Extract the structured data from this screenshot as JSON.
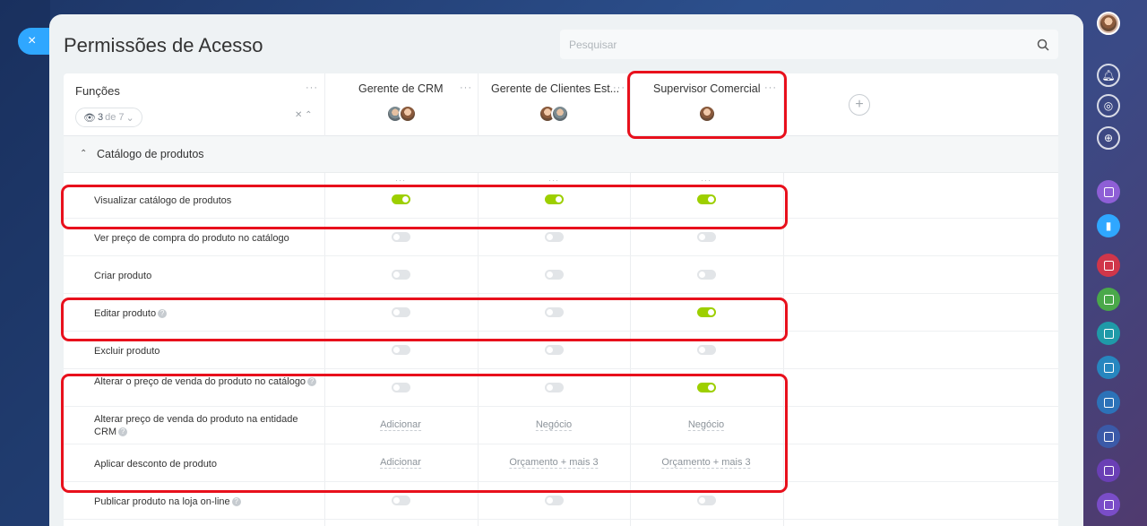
{
  "panel": {
    "title": "Permissões de Acesso",
    "close_label": "×"
  },
  "search": {
    "placeholder": "Pesquisar"
  },
  "roles_column": {
    "label": "Funções",
    "menu": "···",
    "counter_value": "3",
    "counter_of": "de 7",
    "counter_arrow": "⌄"
  },
  "roles": [
    {
      "name": "Gerente de CRM",
      "menu": "···"
    },
    {
      "name": "Gerente de Clientes Est...",
      "menu": "···"
    },
    {
      "name": "Supervisor Comercial",
      "menu": "···"
    }
  ],
  "add_role_label": "+",
  "section": {
    "label": "Catálogo de produtos",
    "expanded": true
  },
  "col_menu": "···",
  "rows": [
    {
      "label": "Visualizar catálogo de produtos",
      "help": false,
      "type": "toggle",
      "values": [
        true,
        true,
        true
      ]
    },
    {
      "label": "Ver preço de compra do produto no catálogo",
      "help": false,
      "type": "toggle",
      "values": [
        false,
        false,
        false
      ]
    },
    {
      "label": "Criar produto",
      "help": false,
      "type": "toggle",
      "values": [
        false,
        false,
        false
      ]
    },
    {
      "label": "Editar produto",
      "help": true,
      "type": "toggle",
      "values": [
        false,
        false,
        true
      ]
    },
    {
      "label": "Excluir produto",
      "help": false,
      "type": "toggle",
      "values": [
        false,
        false,
        false
      ]
    },
    {
      "label": "Alterar o preço de venda do produto no catálogo",
      "help": true,
      "type": "toggle",
      "values": [
        false,
        false,
        true
      ]
    },
    {
      "label": "Alterar preço de venda do produto na entidade CRM",
      "help": true,
      "type": "text",
      "values": [
        "Adicionar",
        "Negócio",
        "Negócio"
      ]
    },
    {
      "label": "Aplicar desconto de produto",
      "help": false,
      "type": "text",
      "values": [
        "Adicionar",
        "Orçamento + mais 3",
        "Orçamento + mais 3"
      ]
    },
    {
      "label": "Publicar produto na loja on-line",
      "help": true,
      "type": "toggle",
      "values": [
        false,
        false,
        false
      ]
    }
  ],
  "help_glyph": "?",
  "colors": {
    "toggle_on": "#9dcf00",
    "toggle_off": "#e2e5e8",
    "highlight": "#e8101c",
    "accent": "#2fa7ff"
  },
  "sidebar_icons": [
    "avatar",
    "bell-icon",
    "copilot-icon",
    "chat-icon",
    "notes-icon",
    "bookmark-icon",
    "task-icon",
    "task-icon",
    "task-icon",
    "task-icon",
    "task-icon",
    "task-icon",
    "notes-icon",
    "notes-icon"
  ]
}
